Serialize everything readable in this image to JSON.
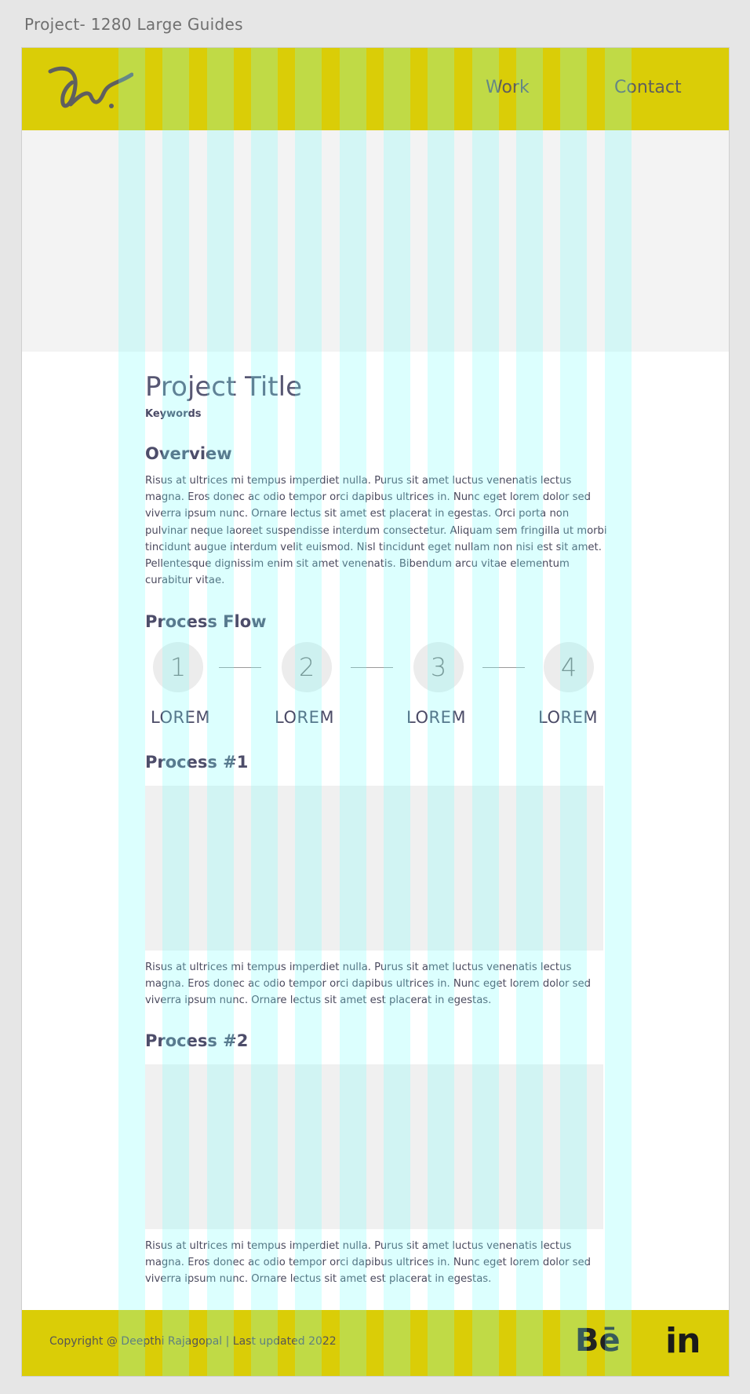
{
  "frame_label": "Project- 1280 Large Guides",
  "nav": {
    "work": "Work",
    "contact": "Contact"
  },
  "title": "Project Title",
  "keywords": "Keywords",
  "overview": {
    "heading": "Overview",
    "text": "Risus at ultrices mi tempus imperdiet nulla. Purus sit amet luctus venenatis lectus magna. Eros donec ac odio tempor orci dapibus ultrices in. Nunc eget lorem dolor sed viverra ipsum nunc. Ornare lectus sit amet est placerat in egestas. Orci porta non pulvinar neque laoreet suspendisse interdum consectetur. Aliquam sem fringilla ut morbi tincidunt augue interdum velit euismod. Nisl tincidunt eget nullam non nisi est sit amet. Pellentesque dignissim enim sit amet venenatis. Bibendum arcu vitae elementum curabitur vitae."
  },
  "process_flow": {
    "heading": "Process Flow",
    "steps": [
      {
        "number": "1",
        "label": "LOREM"
      },
      {
        "number": "2",
        "label": "LOREM"
      },
      {
        "number": "3",
        "label": "LOREM"
      },
      {
        "number": "4",
        "label": "LOREM"
      }
    ]
  },
  "process1": {
    "heading": "Process #1",
    "text": "Risus at ultrices mi tempus imperdiet nulla. Purus sit amet luctus venenatis lectus magna. Eros donec ac odio tempor orci dapibus ultrices in. Nunc eget lorem dolor sed viverra ipsum nunc. Ornare lectus sit amet est placerat in egestas."
  },
  "process2": {
    "heading": "Process #2",
    "text": "Risus at ultrices mi tempus imperdiet nulla. Purus sit amet luctus venenatis lectus magna. Eros donec ac odio tempor orci dapibus ultrices in. Nunc eget lorem dolor sed viverra ipsum nunc. Ornare lectus sit amet est placerat in egestas."
  },
  "footer": {
    "copyright": "Copyright @ Deepthi Rajagopal | Last updated 2022",
    "behance": "Bē",
    "linkedin": "in"
  },
  "colors": {
    "brand_yellow": "#dacd07",
    "guide_cyan": "#78fffa"
  },
  "icons": {
    "logo": "signature-logo-icon",
    "behance": "behance-icon",
    "linkedin": "linkedin-icon"
  }
}
